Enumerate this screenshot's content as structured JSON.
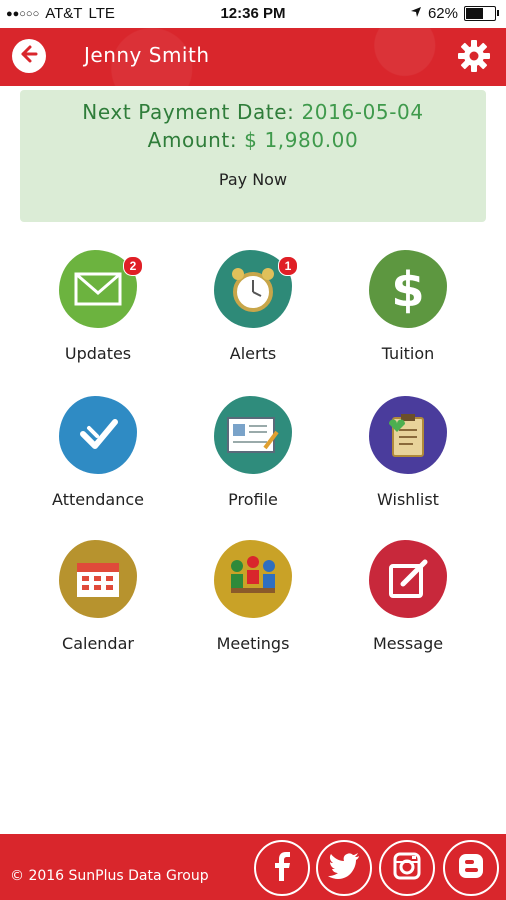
{
  "status": {
    "carrier": "AT&T",
    "network": "LTE",
    "time": "12:36 PM",
    "battery": "62%",
    "battery_level": 0.62
  },
  "header": {
    "title": "Jenny Smith",
    "back_icon": "back-arrow-icon",
    "settings_icon": "gear-icon"
  },
  "payment": {
    "date_label": "Next Payment Date:",
    "date_value": "2016-05-04",
    "amount_label": "Amount:",
    "amount_value": "$ 1,980.00",
    "pay_now": "Pay Now"
  },
  "menu": [
    {
      "label": "Updates",
      "icon": "envelope-icon",
      "color": "#6cb33f",
      "badge": "2"
    },
    {
      "label": "Alerts",
      "icon": "alarm-clock-icon",
      "color": "#2e8a78",
      "badge": "1"
    },
    {
      "label": "Tuition",
      "icon": "dollar-icon",
      "color": "#5d9740",
      "badge": ""
    },
    {
      "label": "Attendance",
      "icon": "checkmark-icon",
      "color": "#2f8bc4",
      "badge": ""
    },
    {
      "label": "Profile",
      "icon": "profile-card-icon",
      "color": "#2f8c7c",
      "badge": ""
    },
    {
      "label": "Wishlist",
      "icon": "clipboard-icon",
      "color": "#4a3c9c",
      "badge": ""
    },
    {
      "label": "Calendar",
      "icon": "calendar-icon",
      "color": "#b7932e",
      "badge": ""
    },
    {
      "label": "Meetings",
      "icon": "meeting-icon",
      "color": "#c9a227",
      "badge": ""
    },
    {
      "label": "Message",
      "icon": "edit-message-icon",
      "color": "#c8283b",
      "badge": ""
    }
  ],
  "footer": {
    "copyright": "© 2016 SunPlus Data Group",
    "social": [
      "facebook-icon",
      "twitter-icon",
      "instagram-icon",
      "blogger-icon"
    ]
  },
  "colors": {
    "brand_red": "#d9262c",
    "card_green_bg": "#dbecd6",
    "card_green_text": "#2f7d3a"
  }
}
